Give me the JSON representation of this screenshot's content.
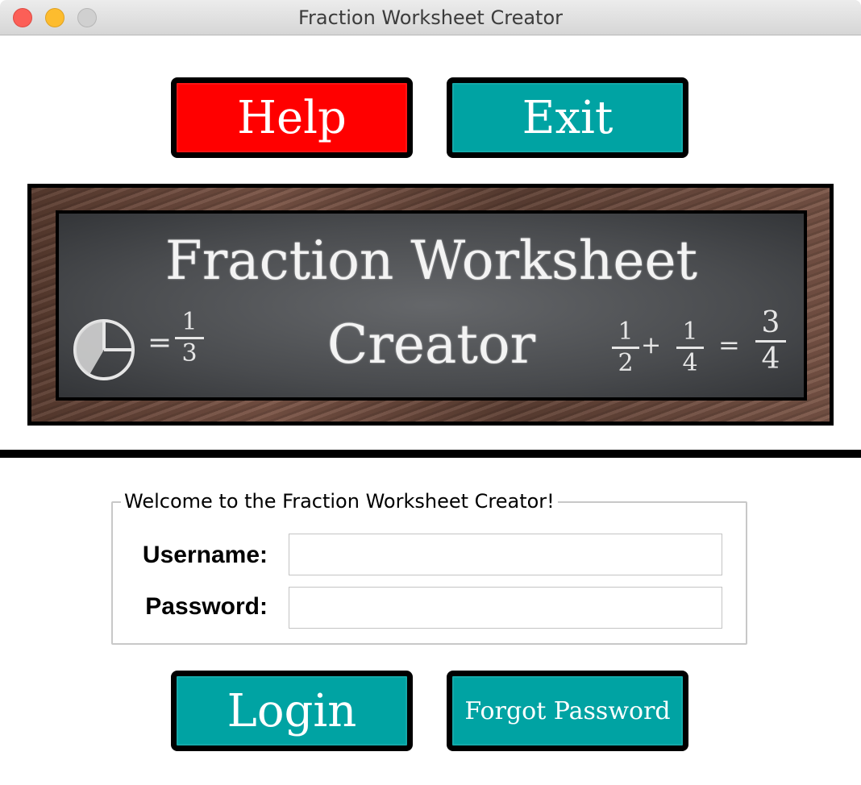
{
  "window": {
    "title": "Fraction Worksheet Creator"
  },
  "top_buttons": {
    "help_label": "Help",
    "exit_label": "Exit"
  },
  "banner": {
    "line1": "Fraction Worksheet",
    "line2": "Creator",
    "left_equation": {
      "equals": "=",
      "fraction": {
        "num": "1",
        "den": "3"
      }
    },
    "right_equation": {
      "term1": {
        "num": "1",
        "den": "2"
      },
      "plus": "+",
      "term2": {
        "num": "1",
        "den": "4"
      },
      "equals": "=",
      "result": {
        "num": "3",
        "den": "4"
      }
    }
  },
  "login": {
    "legend": "Welcome to the Fraction Worksheet Creator!",
    "username_label": "Username:",
    "username_value": "",
    "password_label": "Password:",
    "password_value": ""
  },
  "bottom_buttons": {
    "login_label": "Login",
    "forgot_label": "Forgot Password"
  },
  "colors": {
    "help": "#ff0000",
    "teal": "#00a3a3",
    "chalkboard": "#55575a",
    "wood": "#6b4a3d"
  },
  "icons": [
    "window-close-icon",
    "window-minimize-icon",
    "window-zoom-icon",
    "pie-chart-third-icon"
  ]
}
